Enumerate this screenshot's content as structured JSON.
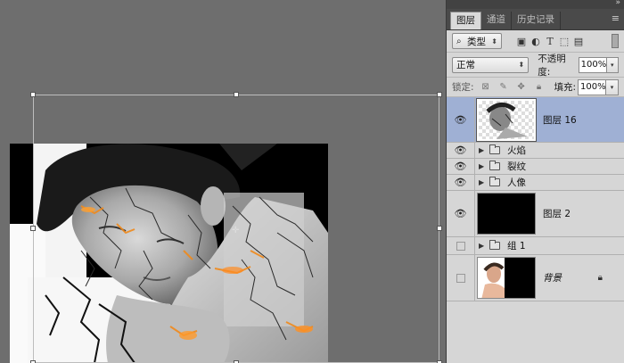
{
  "panel": {
    "tabs": [
      {
        "label": "图层",
        "active": true
      },
      {
        "label": "通道",
        "active": false
      },
      {
        "label": "历史记录",
        "active": false
      }
    ],
    "filter": {
      "kind_label": "类型",
      "icons": [
        "image-filter-icon",
        "adjustment-filter-icon",
        "type-filter-icon",
        "shape-filter-icon",
        "smart-object-filter-icon"
      ]
    },
    "blend": {
      "mode": "正常",
      "opacity_label": "不透明度:",
      "opacity_value": "100%"
    },
    "lock": {
      "label": "锁定:",
      "fill_label": "填充:",
      "fill_value": "100%"
    },
    "layers": [
      {
        "name": "图层 16",
        "kind": "image",
        "visible": true,
        "selected": true
      },
      {
        "name": "火焰",
        "kind": "group",
        "visible": true,
        "selected": false
      },
      {
        "name": "裂纹",
        "kind": "group",
        "visible": true,
        "selected": false
      },
      {
        "name": "人像",
        "kind": "group",
        "visible": true,
        "selected": false
      },
      {
        "name": "图层 2",
        "kind": "image",
        "visible": true,
        "selected": false
      },
      {
        "name": "组 1",
        "kind": "group",
        "visible": false,
        "selected": false
      },
      {
        "name": "背景",
        "kind": "background",
        "visible": false,
        "selected": false,
        "locked": true
      }
    ]
  },
  "colors": {
    "workspace": "#6d6d6d",
    "panel_bg": "#d6d6d6",
    "selection": "#9fb0d4",
    "fire": "#f08a1c"
  }
}
